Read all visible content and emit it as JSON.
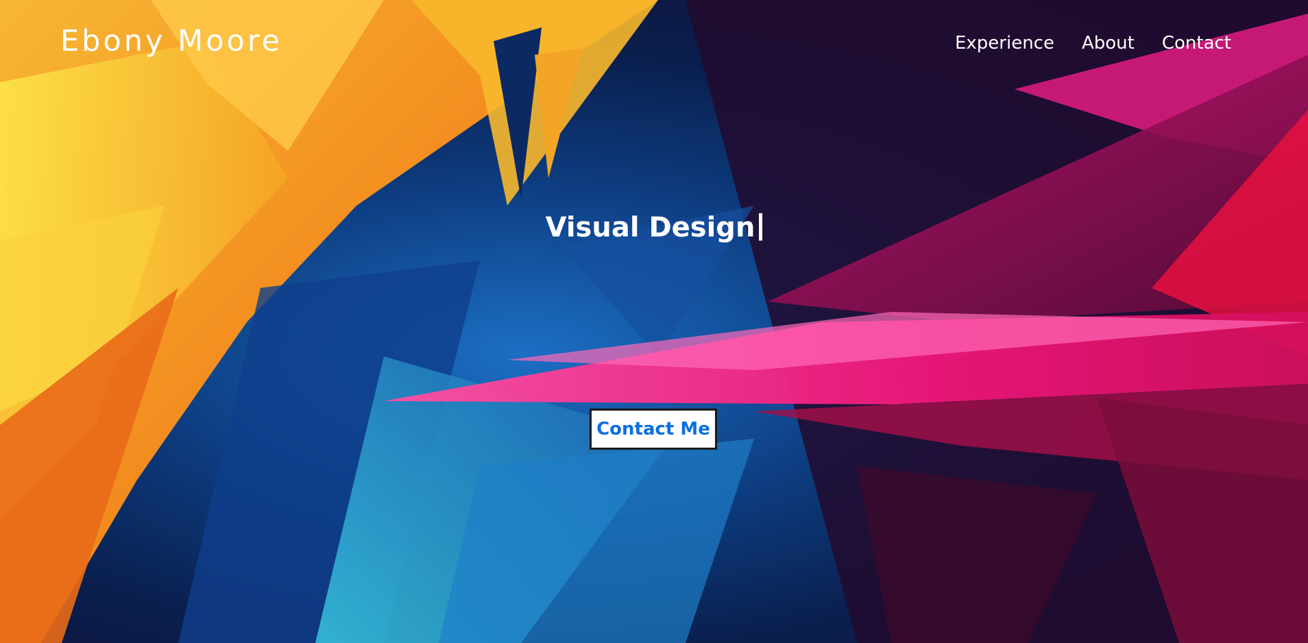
{
  "header": {
    "brand_name": "Ebony Moore",
    "nav": [
      {
        "label": "Experience"
      },
      {
        "label": "About"
      },
      {
        "label": "Contact"
      }
    ]
  },
  "hero": {
    "headline": "Visual Design",
    "cta_label": "Contact Me"
  },
  "colors": {
    "text": "#ffffff",
    "cta_background": "#ffffff",
    "cta_text": "#0b6fe0",
    "cta_border": "#1a1a1a",
    "background_orange": "#f5a623",
    "background_blue": "#0d3b7e",
    "background_magenta": "#e8166e"
  }
}
